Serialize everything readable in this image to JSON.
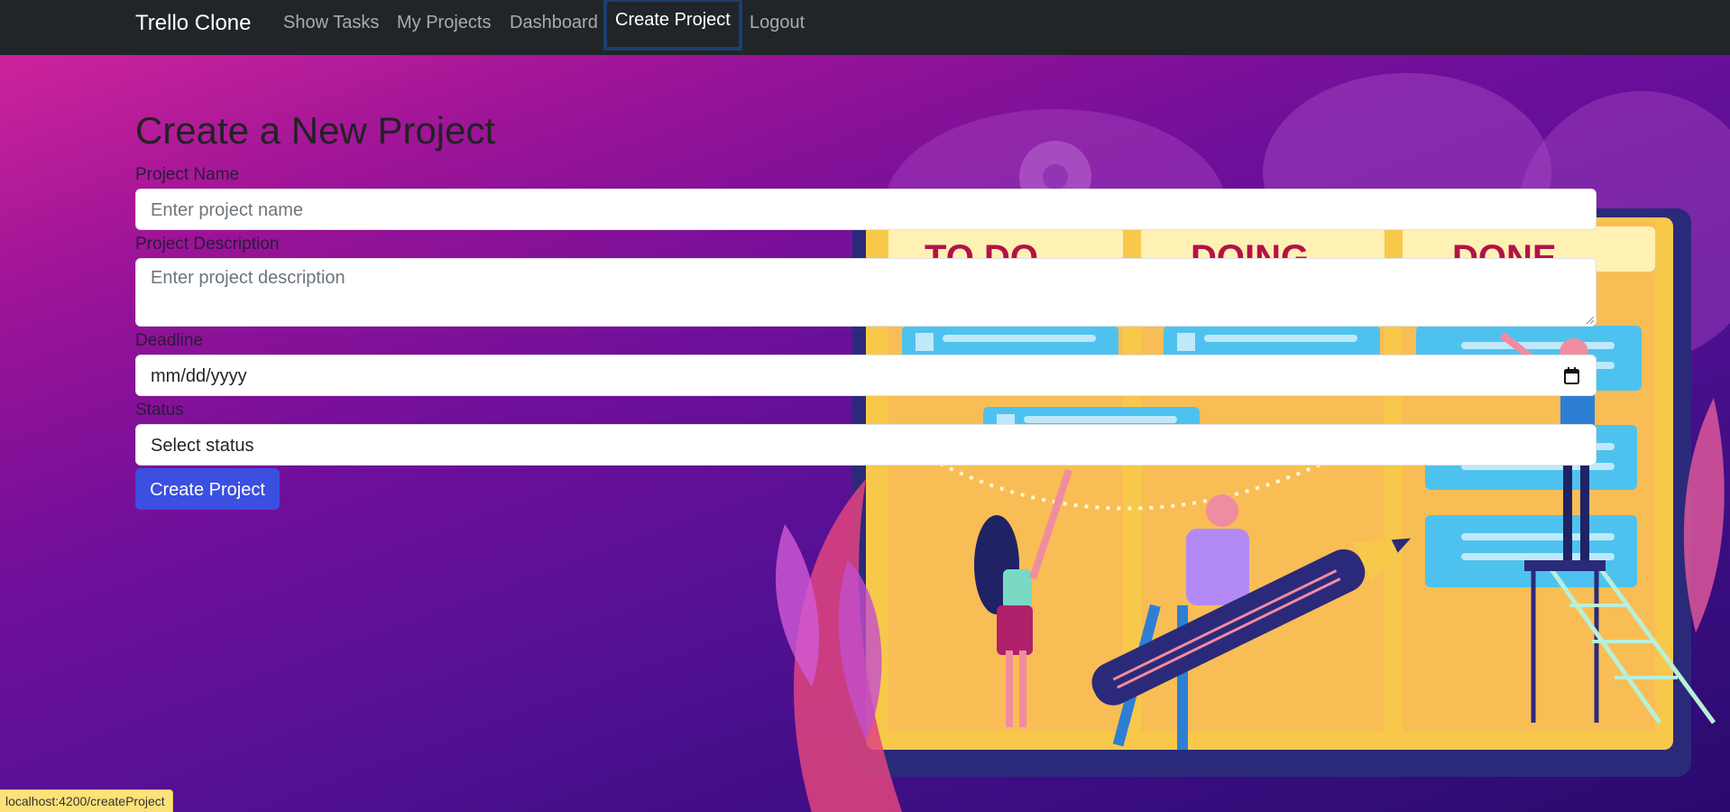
{
  "navbar": {
    "brand": "Trello Clone",
    "links": [
      "Show Tasks",
      "My Projects",
      "Dashboard",
      "Create Project",
      "Logout"
    ],
    "active": "Create Project"
  },
  "form": {
    "title": "Create a New Project",
    "project_name": {
      "label": "Project Name",
      "placeholder": "Enter project name",
      "value": ""
    },
    "project_description": {
      "label": "Project Description",
      "placeholder": "Enter project description",
      "value": ""
    },
    "deadline": {
      "label": "Deadline",
      "placeholder": "mm/dd/yyyy",
      "value": ""
    },
    "status": {
      "label": "Status",
      "selected": "Select status"
    },
    "submit_label": "Create Project"
  },
  "board_columns": [
    "TO DO",
    "DOING",
    "DONE"
  ],
  "status_bar": {
    "url": "localhost:4200/createProject"
  },
  "colors": {
    "navbar_bg": "#212529",
    "primary_button": "#3b4fe0",
    "gradient_top": "#d8279c",
    "gradient_bottom": "#2a0a6e",
    "board_yellow": "#f6c94a",
    "card_blue": "#4ec2ee"
  }
}
